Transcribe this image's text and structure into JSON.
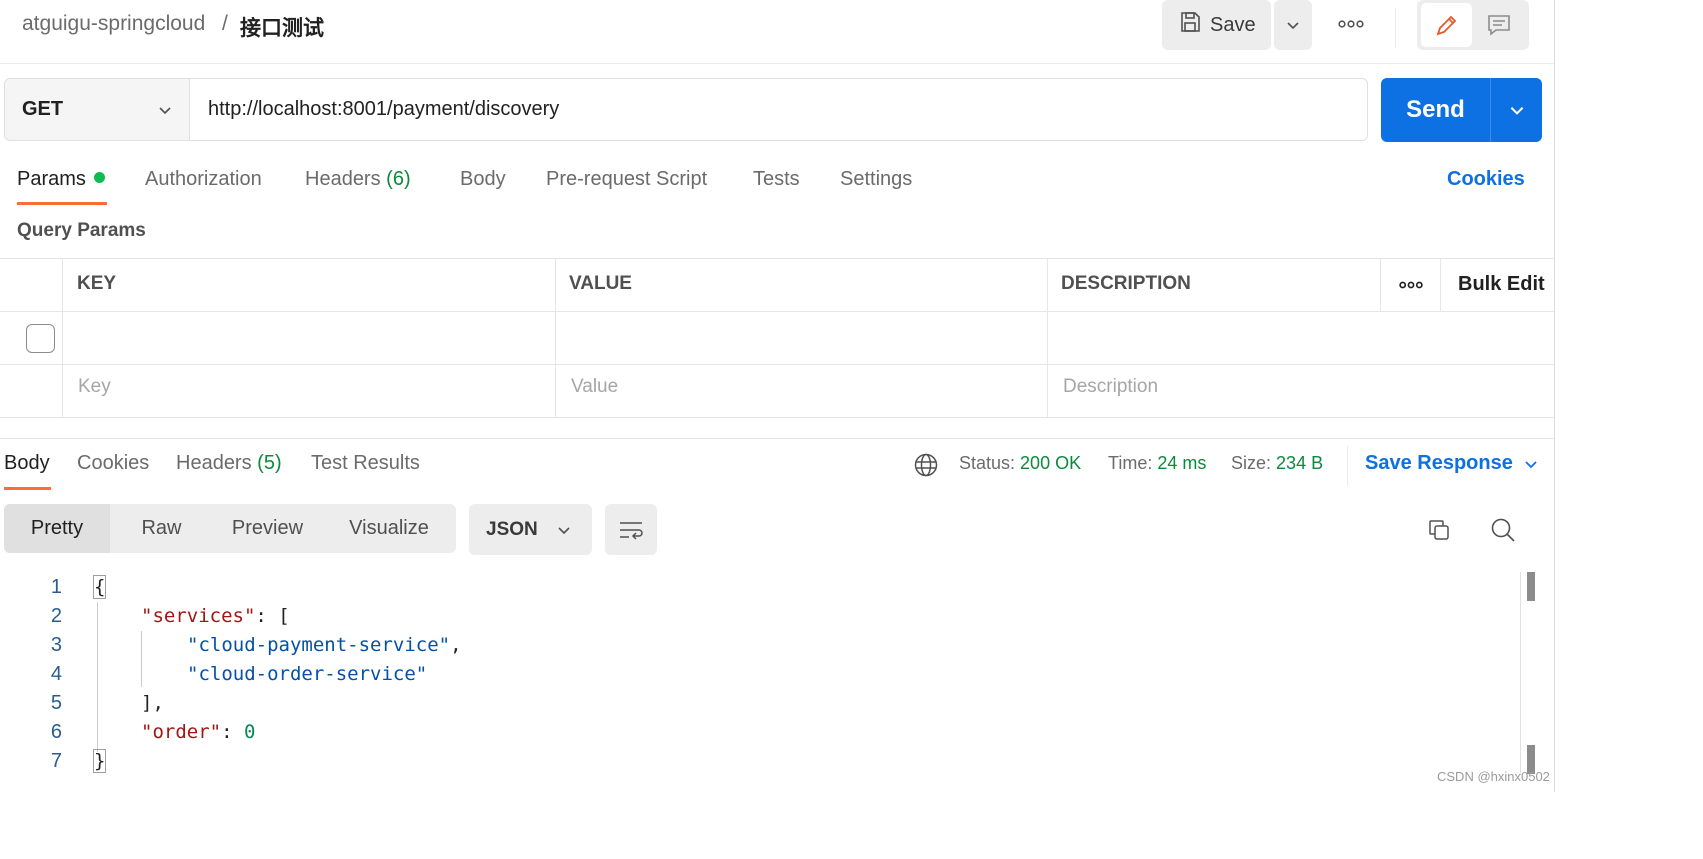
{
  "breadcrumb": {
    "collection": "atguigu-springcloud",
    "separator": "/",
    "request_name": "接口测试"
  },
  "toolbar": {
    "save_label": "Save"
  },
  "request": {
    "method": "GET",
    "url": "http://localhost:8001/payment/discovery",
    "send_label": "Send"
  },
  "request_tabs": [
    {
      "label": "Params"
    },
    {
      "label": "Authorization"
    },
    {
      "label": "Headers",
      "count": "(6)"
    },
    {
      "label": "Body"
    },
    {
      "label": "Pre-request Script"
    },
    {
      "label": "Tests"
    },
    {
      "label": "Settings"
    }
  ],
  "cookies_label": "Cookies",
  "query_params": {
    "title": "Query Params",
    "columns": [
      "KEY",
      "VALUE",
      "DESCRIPTION"
    ],
    "bulk_edit": "Bulk Edit",
    "placeholders": {
      "key": "Key",
      "value": "Value",
      "description": "Description"
    }
  },
  "response_tabs": [
    {
      "label": "Body"
    },
    {
      "label": "Cookies"
    },
    {
      "label": "Headers",
      "count": "(5)"
    },
    {
      "label": "Test Results"
    }
  ],
  "response_meta": {
    "status_label": "Status:",
    "status_value": "200 OK",
    "time_label": "Time:",
    "time_value": "24 ms",
    "size_label": "Size:",
    "size_value": "234 B",
    "save_response": "Save Response"
  },
  "view_modes": [
    "Pretty",
    "Raw",
    "Preview",
    "Visualize"
  ],
  "format": "JSON",
  "code": {
    "line_numbers": [
      "1",
      "2",
      "3",
      "4",
      "5",
      "6",
      "7"
    ],
    "open_brace": "{",
    "services_key": "\"services\"",
    "colon_bracket": ": [",
    "item1": "\"cloud-payment-service\"",
    "comma": ",",
    "item2": "\"cloud-order-service\"",
    "close_bracket": "],",
    "order_key": "\"order\"",
    "colon": ": ",
    "order_value": "0",
    "close_brace": "}"
  },
  "watermark": "CSDN @hxinx0502",
  "colors": {
    "accent_orange": "#ff6c37",
    "primary_blue": "#0d71e3",
    "success_green": "#0c8a3c"
  }
}
